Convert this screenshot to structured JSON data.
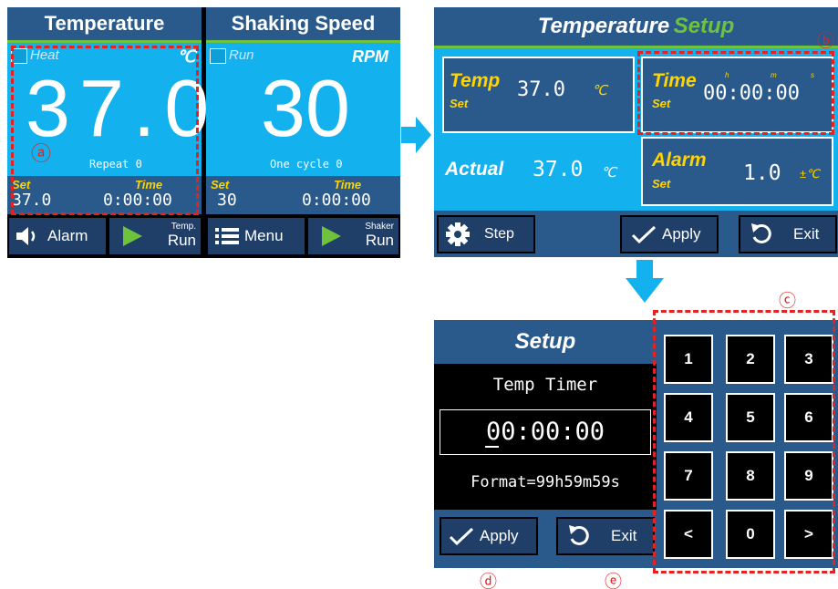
{
  "main": {
    "temperature": {
      "title": "Temperature",
      "heat_label": "Heat",
      "unit": "℃",
      "value": "37.0",
      "repeat": "Repeat 0",
      "set_label": "Set",
      "time_label": "Time",
      "set_value": "37.0",
      "time_value": "0:00:00",
      "alarm_button": "Alarm",
      "run_button_top": "Temp.",
      "run_button_bottom": "Run"
    },
    "shaking": {
      "title": "Shaking Speed",
      "run_label": "Run",
      "unit": "RPM",
      "value": "30",
      "cycle": "One cycle 0",
      "set_label": "Set",
      "time_label": "Time",
      "set_value": "30",
      "time_value": "0:00:00",
      "menu_button": "Menu",
      "run_button_top": "Shaker",
      "run_button_bottom": "Run"
    }
  },
  "temp_setup": {
    "title_word1": "Temperature",
    "title_word2": "Setup",
    "temp_label": "Temp",
    "set_small": "Set",
    "temp_value": "37.0",
    "temp_unit": "℃",
    "time_label": "Time",
    "h": "h",
    "m": "m",
    "s": "s",
    "time_value": "00:00:00",
    "actual_label": "Actual",
    "actual_value": "37.0",
    "actual_unit": "℃",
    "alarm_label": "Alarm",
    "alarm_value": "1.0",
    "alarm_unit": "±℃",
    "step_button": "Step",
    "apply_button": "Apply",
    "exit_button": "Exit"
  },
  "timer_setup": {
    "title": "Setup",
    "subtitle": "Temp Timer",
    "value": "00:00:00",
    "format": "Format=99h59m59s",
    "apply_button": "Apply",
    "exit_button": "Exit"
  },
  "keypad": [
    "1",
    "2",
    "3",
    "4",
    "5",
    "6",
    "7",
    "8",
    "9",
    "<",
    "0",
    ">"
  ],
  "markers": {
    "a": "ⓐ",
    "b": "ⓑ",
    "c": "ⓒ",
    "d": "ⓓ",
    "e": "ⓔ"
  },
  "colors": {
    "cyan": "#13b2ef",
    "navy": "#2a5a8c",
    "accent_yellow": "#ffd400",
    "accent_green": "#6fc23b",
    "annotation_red": "#e32222"
  }
}
